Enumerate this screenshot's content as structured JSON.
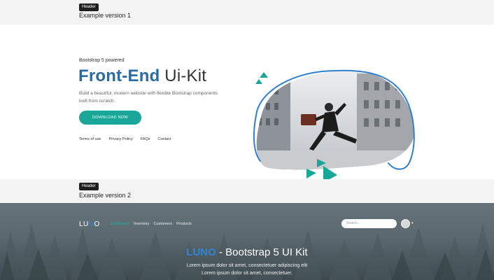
{
  "sections": [
    {
      "badge": "Header",
      "title": "Example version 1"
    },
    {
      "badge": "Header",
      "title": "Example version 2"
    }
  ],
  "hero": {
    "kicker": "Bootstrap 5 powered",
    "title_accent": "Front-End",
    "title_rest": " Ui-Kit",
    "description": "Build a beautiful, modern website with flexible Bootstrap components built from scratch.",
    "cta": "DOWNLOAD NOW",
    "links": [
      "Terms of use",
      "Privacy Policy",
      "FAQs",
      "Contact"
    ],
    "accent_color": "#2b6aa3",
    "cta_color": "#1aa79a"
  },
  "navbar": {
    "logo_prefix": "LU",
    "logo_accent": "N",
    "logo_suffix": "O",
    "items": [
      "Dashboard",
      "Inventory",
      "Customers",
      "Products"
    ],
    "active_item": "Dashboard",
    "search_placeholder": "Search..."
  },
  "banner": {
    "brand": "LUNO",
    "title_rest": " - Bootstrap 5 UI Kit",
    "line1": "Lorem ipsum dolor sit amet, consectetuer adipiscing elit",
    "line2": "Lorem ipsum dolor sit amet, consectetuer."
  }
}
